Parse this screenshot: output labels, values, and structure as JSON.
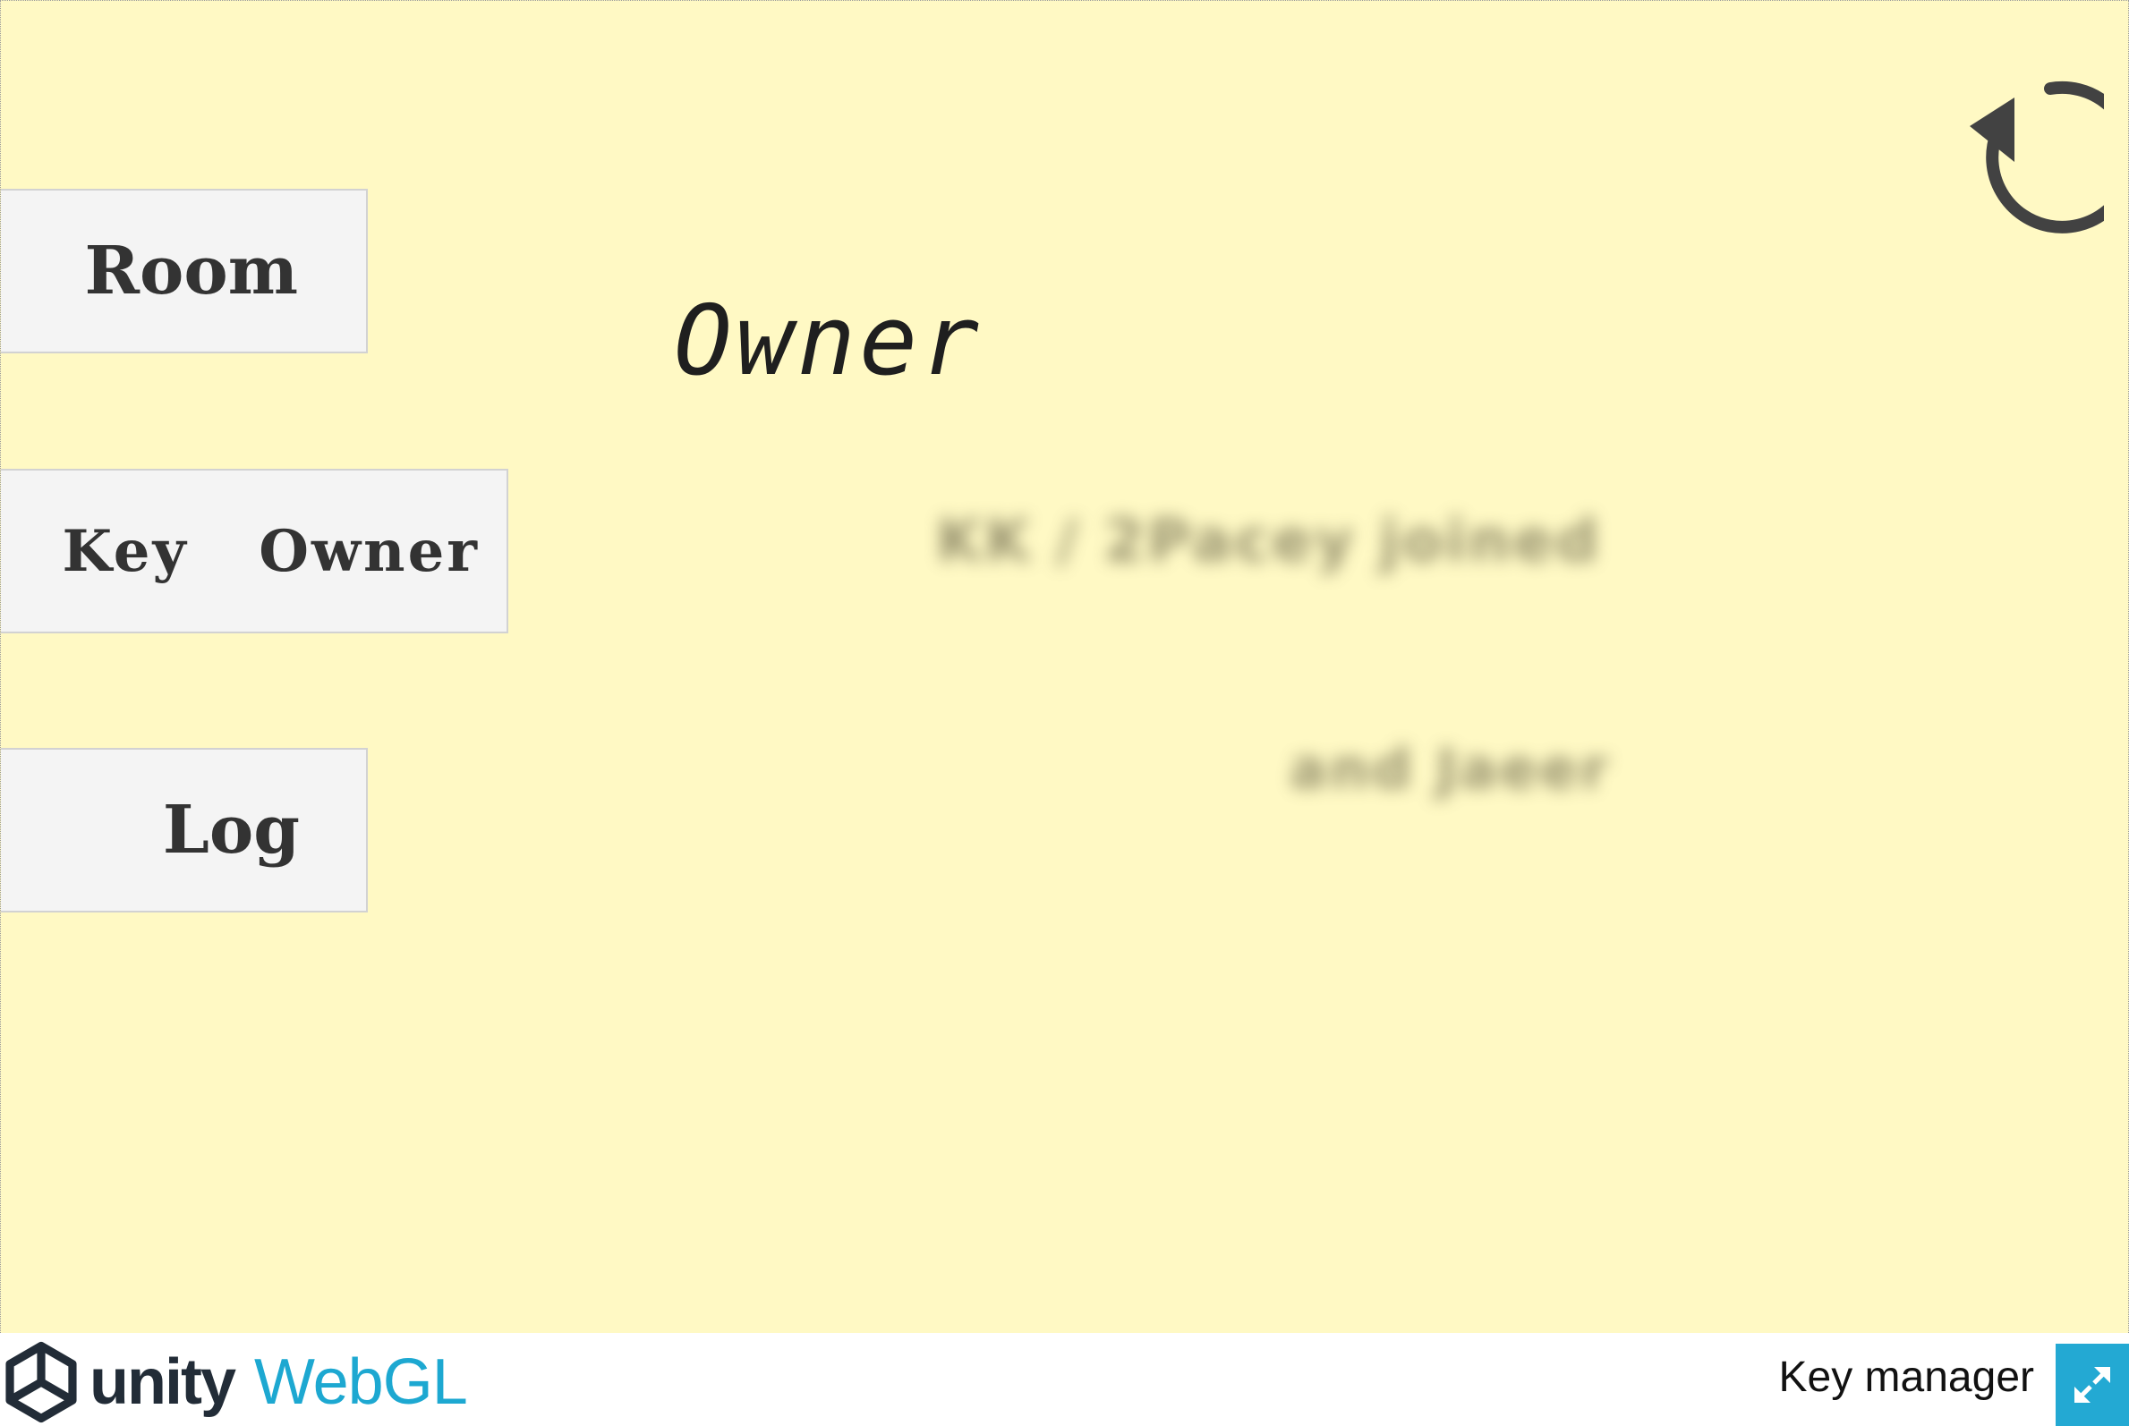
{
  "app": {
    "title": "Key manager"
  },
  "nav": {
    "room_label": "Room",
    "key_owner_label": "Key  Owner",
    "log_label": "Log"
  },
  "main": {
    "heading": "Owner",
    "blurred_line_1": "KK / 2Pacey joined",
    "blurred_line_2": "and Jaeer"
  },
  "footer": {
    "brand_unity": "unity",
    "brand_webgl": "WebGL"
  },
  "icons": {
    "refresh": "refresh-icon",
    "fullscreen": "fullscreen-icon",
    "unity_logo": "unity-logo-icon"
  },
  "colors": {
    "background": "#fff9c4",
    "button_face": "#f4f4f4",
    "accent": "#23a9d3",
    "icon_dark": "#424242"
  }
}
